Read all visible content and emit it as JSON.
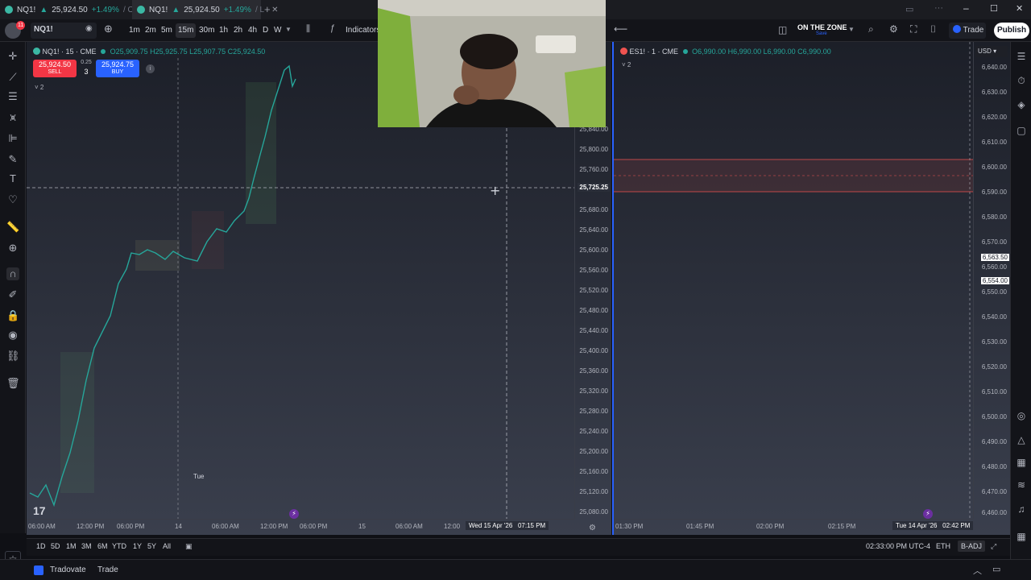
{
  "tabs": [
    {
      "symbol": "NQ1!",
      "arrow": "▲",
      "price": "25,924.50",
      "change": "+1.49%",
      "rest": "/ O"
    },
    {
      "symbol": "NQ1!",
      "arrow": "▲",
      "price": "25,924.50",
      "change": "+1.49%",
      "rest": "/ L"
    }
  ],
  "toolbar": {
    "symbol": "NQ1!",
    "notif_count": "11",
    "intervals": [
      "1m",
      "2m",
      "5m",
      "15m",
      "30m",
      "1h",
      "2h",
      "4h",
      "D",
      "W"
    ],
    "selected_interval": "15m",
    "indicators_label": "Indicators",
    "layout_name": "ON THE ZONE",
    "layout_sub": "Save",
    "trade_label": "Trade",
    "publish_label": "Publish"
  },
  "chart1": {
    "legend_symbol": "NQ1! · 15 · CME",
    "ohlc": "O25,909.75 H25,925.75 L25,907.75 C25,924.50",
    "sell_price": "25,924.50",
    "sell_label": "SELL",
    "spread": "0.25",
    "qty": "3",
    "buy_price": "25,924.75",
    "buy_label": "BUY",
    "collapse_count": "2",
    "prices": [
      "25,840.00",
      "25,800.00",
      "25,760.00",
      "25,680.00",
      "25,640.00",
      "25,600.00",
      "25,560.00",
      "25,520.00",
      "25,480.00",
      "25,440.00",
      "25,400.00",
      "25,360.00",
      "25,320.00",
      "25,280.00",
      "25,240.00",
      "25,200.00",
      "25,160.00",
      "25,120.00",
      "25,080.00"
    ],
    "crosshair_price": "25,725.25",
    "times": [
      "06:00 AM",
      "12:00 PM",
      "06:00 PM",
      "14",
      "06:00 AM",
      "12:00 PM",
      "06:00 PM",
      "15",
      "06:00 AM",
      "12:00"
    ],
    "crosshair_time": "Wed 15 Apr '26   07:15 PM",
    "day_label": "Tue"
  },
  "chart2": {
    "legend_symbol": "ES1! · 1 · CME",
    "ohlc": "O6,990.00 H6,990.00 L6,990.00 C6,990.00",
    "collapse_count": "2",
    "currency": "USD",
    "prices": [
      "6,640.00",
      "6,630.00",
      "6,620.00",
      "6,610.00",
      "6,600.00",
      "6,590.00",
      "6,580.00",
      "6,570.00",
      "6,560.00",
      "6,550.00",
      "6,540.00",
      "6,530.00",
      "6,520.00",
      "6,510.00",
      "6,500.00",
      "6,490.00",
      "6,480.00",
      "6,470.00",
      "6,460.00"
    ],
    "marker1": "6,563.50",
    "marker2": "6,554.00",
    "times": [
      "01:30 PM",
      "01:45 PM",
      "02:00 PM",
      "02:15 PM"
    ],
    "crosshair_time": "Tue 14 Apr '26   02:42 PM"
  },
  "rangebar": {
    "ranges": [
      "1D",
      "5D",
      "1M",
      "3M",
      "6M",
      "YTD",
      "1Y",
      "5Y",
      "All"
    ],
    "clock": "02:33:00 PM UTC-4",
    "session": "ETH",
    "adj": "B-ADJ"
  },
  "bottombar": {
    "broker": "Tradovate",
    "trade": "Trade"
  },
  "colors": {
    "accent": "#2962ff",
    "up": "#26a69a",
    "down": "#ef5350",
    "sell": "#f23645",
    "buy": "#2962ff"
  }
}
